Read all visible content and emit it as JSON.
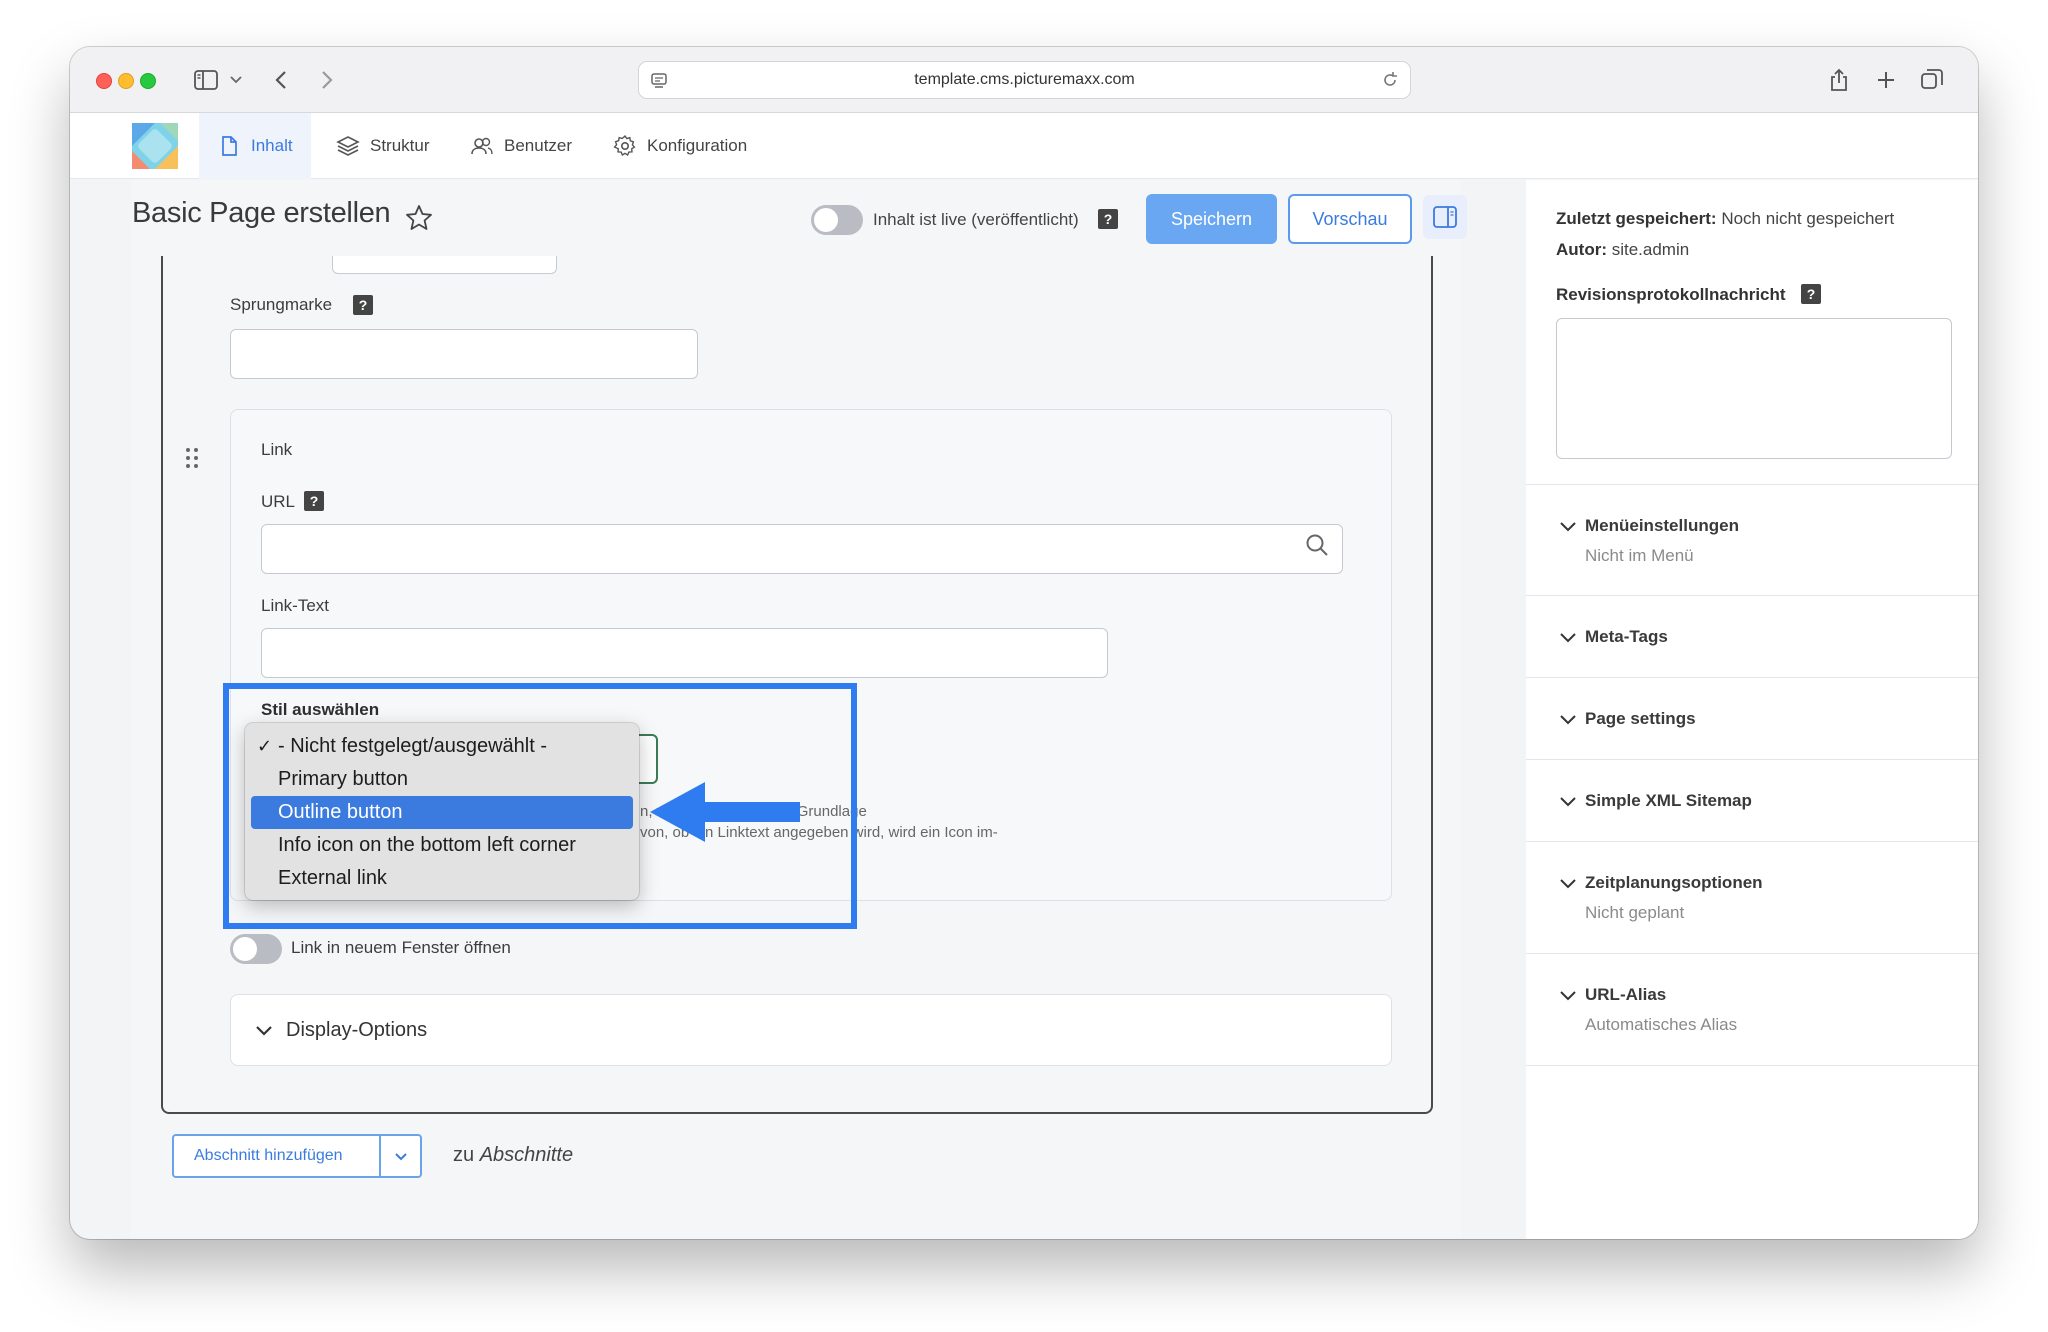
{
  "browser": {
    "url": "template.cms.picturemaxx.com"
  },
  "nav": {
    "items": [
      {
        "label": "Inhalt"
      },
      {
        "label": "Struktur"
      },
      {
        "label": "Benutzer"
      },
      {
        "label": "Konfiguration"
      }
    ]
  },
  "header": {
    "title": "Basic Page erstellen",
    "live_label": "Inhalt ist live (veröffentlicht)",
    "save_label": "Speichern",
    "preview_label": "Vorschau"
  },
  "form": {
    "anchor_label": "Sprungmarke",
    "link_group_label": "Link",
    "url_label": "URL",
    "url_value": "",
    "link_text_label": "Link-Text",
    "link_text_value": "",
    "style_label": "Stil auswählen",
    "help_line1": "n, wird der Link auf der Grundlage",
    "help_line2": "von, ob ein Linktext angegeben wird, wird ein Icon im-",
    "help_line1_prefix": "e",
    "new_window_label": "Link in neuem Fenster öffnen",
    "display_options_label": "Display-Options",
    "add_section_label": "Abschnitt hinzufügen",
    "zu_prefix": "zu",
    "zu_target": "Abschnitte"
  },
  "style_dropdown": {
    "options": [
      {
        "label": "- Nicht festgelegt/ausgewählt -",
        "checked": true
      },
      {
        "label": "Primary button"
      },
      {
        "label": "Outline button",
        "highlighted": true
      },
      {
        "label": "Info icon on the bottom left corner"
      },
      {
        "label": "External link"
      }
    ]
  },
  "sidebar": {
    "last_saved_key": "Zuletzt gespeichert:",
    "last_saved_value": "Noch nicht gespeichert",
    "author_key": "Autor:",
    "author_value": "site.admin",
    "revision_label": "Revisionsprotokollnachricht",
    "sections": [
      {
        "title": "Menüeinstellungen",
        "sub": "Nicht im Menü"
      },
      {
        "title": "Meta-Tags"
      },
      {
        "title": "Page settings"
      },
      {
        "title": "Simple XML Sitemap"
      },
      {
        "title": "Zeitplanungsoptionen",
        "sub": "Nicht geplant"
      },
      {
        "title": "URL-Alias",
        "sub": "Automatisches Alias"
      }
    ]
  },
  "colors": {
    "accent": "#3b7be0",
    "save_button": "#6aa7f3",
    "highlight_frame": "#2f7bf0"
  }
}
